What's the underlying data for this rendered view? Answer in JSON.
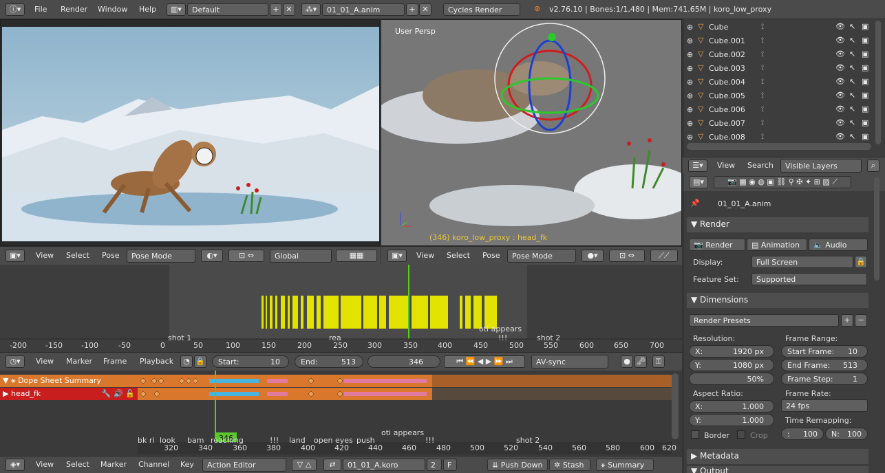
{
  "topbar": {
    "menus": [
      "File",
      "Render",
      "Window",
      "Help"
    ],
    "layout": "Default",
    "scene": "01_01_A.anim",
    "engine": "Cycles Render",
    "stats": "v2.76.10 | Bones:1/1,480  | Mem:741.65M | koro_low_proxy"
  },
  "viewport_left": {
    "header": {
      "menus": [
        "View",
        "Select",
        "Pose"
      ],
      "mode": "Pose Mode",
      "orientation": "Global"
    }
  },
  "viewport_right": {
    "label": "User Persp",
    "status": "(346) koro_low_proxy : head_fk",
    "header": {
      "menus": [
        "View",
        "Select",
        "Pose"
      ],
      "mode": "Pose Mode"
    }
  },
  "outliner": {
    "items": [
      "Cube",
      "Cube.001",
      "Cube.002",
      "Cube.003",
      "Cube.004",
      "Cube.005",
      "Cube.006",
      "Cube.007",
      "Cube.008"
    ],
    "menus": [
      "View",
      "Search"
    ],
    "filter": "Visible Layers"
  },
  "properties": {
    "object": "01_01_A.anim",
    "render_panel": "Render",
    "buttons": [
      "Render",
      "Animation",
      "Audio"
    ],
    "display_label": "Display:",
    "display": "Full Screen",
    "feature_label": "Feature Set:",
    "feature": "Supported",
    "dimensions_panel": "Dimensions",
    "presets": "Render Presets",
    "resolution_label": "Resolution:",
    "res_x": "1920 px",
    "res_y": "1080 px",
    "res_pct": "50%",
    "frame_range_label": "Frame Range:",
    "start_frame": "10",
    "end_frame": "513",
    "frame_step": "1",
    "aspect_label": "Aspect Ratio:",
    "aspect_x": "1.000",
    "aspect_y": "1.000",
    "frame_rate_label": "Frame Rate:",
    "frame_rate": "24 fps",
    "time_remap_label": "Time Remapping:",
    "remap_old": "100",
    "remap_new": "100",
    "border": "Border",
    "crop": "Crop",
    "metadata": "Metadata",
    "output": "Output"
  },
  "timeline": {
    "ticks": [
      "-200",
      "-150",
      "-100",
      "-50",
      "0",
      "50",
      "100",
      "150",
      "200",
      "250",
      "300",
      "350",
      "400",
      "450",
      "500",
      "550",
      "600",
      "650",
      "700"
    ],
    "markers": [
      "shot 1",
      "oti appears",
      "shot 2",
      "!!!",
      "rea"
    ],
    "header": {
      "menus": [
        "View",
        "Marker",
        "Frame",
        "Playback"
      ],
      "start_label": "Start:",
      "start": "10",
      "end_label": "End:",
      "end": "513",
      "current": "346",
      "sync": "AV-sync"
    }
  },
  "dopesheet": {
    "rows": [
      "Dope Sheet Summary",
      "head_fk"
    ],
    "ticks": [
      "320",
      "340",
      "360",
      "380",
      "400",
      "420",
      "440",
      "460",
      "480",
      "500",
      "520",
      "540",
      "560",
      "580",
      "600",
      "620"
    ],
    "current": "346",
    "markers": [
      "bk ri",
      "look",
      "bam",
      "reaching",
      "!!!",
      "land",
      "open eyes",
      "push",
      "oti appears",
      "!!!",
      "shot 2"
    ],
    "header": {
      "menus": [
        "View",
        "Select",
        "Marker",
        "Channel",
        "Key"
      ],
      "mode": "Action Editor",
      "action": "01_01_A.koro",
      "users": "2",
      "f": "F",
      "pushdown": "Push Down",
      "stash": "Stash",
      "summary": "Summary"
    }
  },
  "colors": {
    "yellow": "#e2e300",
    "orange": "#d9782c",
    "green": "#5ac72a",
    "red": "#c81e1e"
  }
}
